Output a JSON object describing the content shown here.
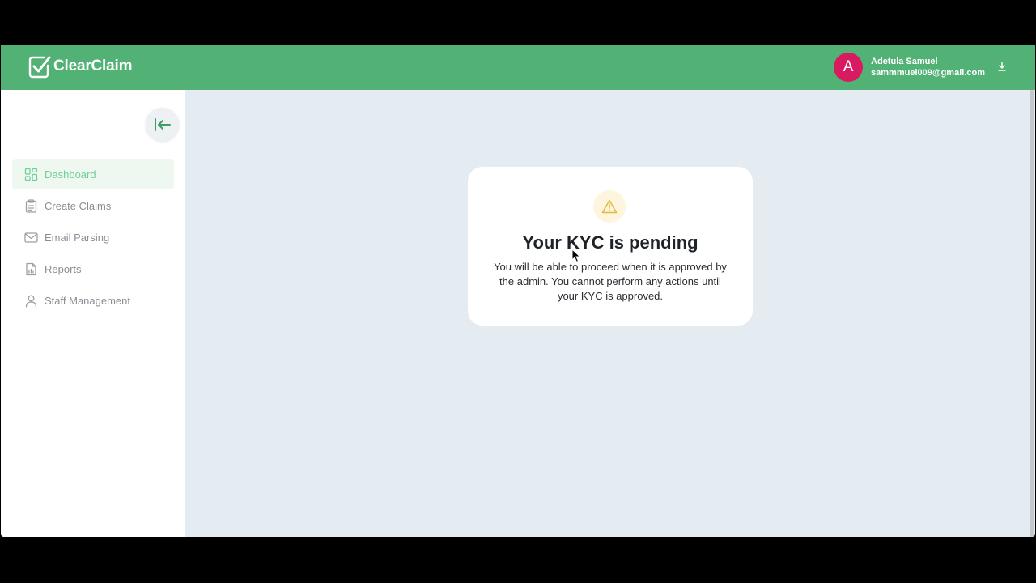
{
  "brand": {
    "name": "ClearClaim"
  },
  "user": {
    "initial": "A",
    "name": "Adetula Samuel",
    "email": "sammmuel009@gmail.com",
    "avatar_color": "#d81b60"
  },
  "colors": {
    "header": "#52b174",
    "active_nav_text": "#6fcf97",
    "content_bg": "#e4ebf1",
    "warning_icon": "#e2b93b"
  },
  "sidebar": {
    "collapse_icon": "collapse-left-icon",
    "items": [
      {
        "label": "Dashboard",
        "icon": "dashboard-grid-icon",
        "active": true
      },
      {
        "label": "Create Claims",
        "icon": "clipboard-icon",
        "active": false
      },
      {
        "label": "Email Parsing",
        "icon": "mail-icon",
        "active": false
      },
      {
        "label": "Reports",
        "icon": "report-icon",
        "active": false
      },
      {
        "label": "Staff Management",
        "icon": "user-icon",
        "active": false
      }
    ]
  },
  "kyc_notice": {
    "icon": "warning-icon",
    "title": "Your KYC is pending",
    "message": "You will be able to proceed when it is approved by the admin. You cannot perform any actions until your KYC is approved."
  }
}
